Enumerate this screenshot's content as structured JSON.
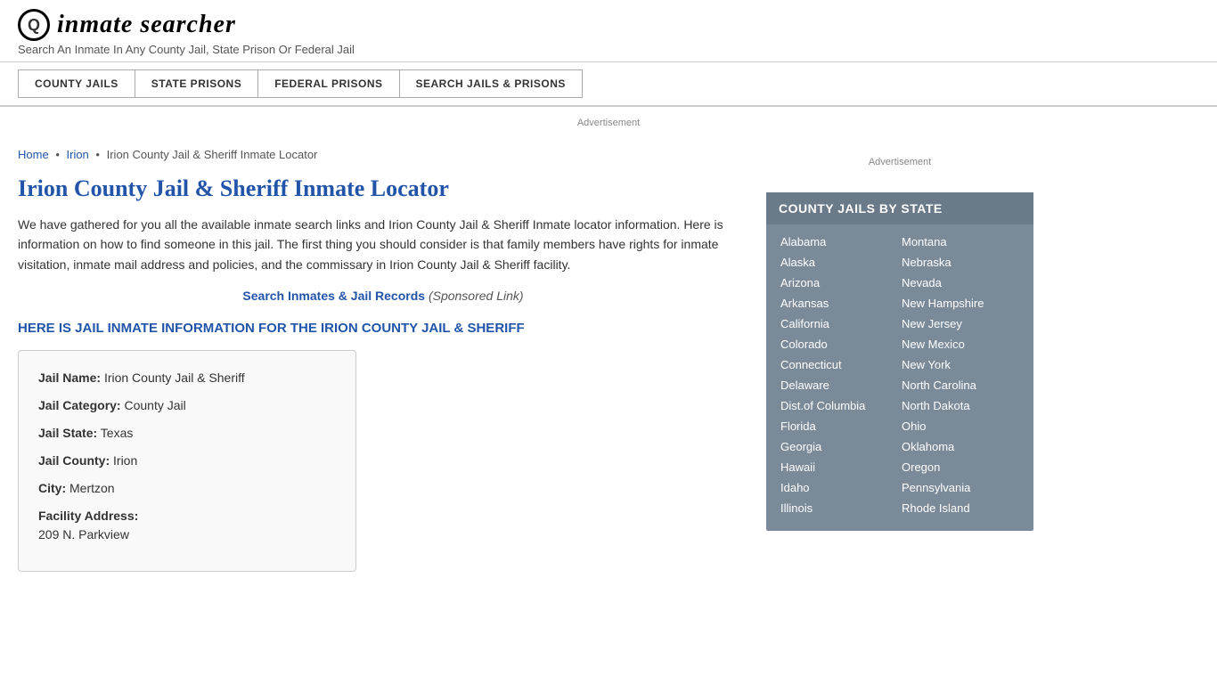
{
  "header": {
    "logo_icon": "🔍",
    "logo_text": "inmate searcher",
    "tagline": "Search An Inmate In Any County Jail, State Prison Or Federal Jail"
  },
  "nav": {
    "items": [
      {
        "label": "COUNTY JAILS",
        "name": "county-jails"
      },
      {
        "label": "STATE PRISONS",
        "name": "state-prisons"
      },
      {
        "label": "FEDERAL PRISONS",
        "name": "federal-prisons"
      },
      {
        "label": "SEARCH JAILS & PRISONS",
        "name": "search-jails-prisons"
      }
    ]
  },
  "ad": {
    "top_label": "Advertisement",
    "sidebar_label": "Advertisement"
  },
  "breadcrumb": {
    "home": "Home",
    "sep1": "•",
    "irion": "Irion",
    "sep2": "•",
    "current": "Irion County Jail & Sheriff Inmate Locator"
  },
  "content": {
    "page_title": "Irion County Jail & Sheriff Inmate Locator",
    "description": "We have gathered for you all the available inmate search links and Irion County Jail & Sheriff Inmate locator information. Here is information on how to find someone in this jail. The first thing you should consider is that family members have rights for inmate visitation, inmate mail address and policies, and the commissary in Irion County Jail & Sheriff facility.",
    "sponsored_link_text": "Search Inmates & Jail Records",
    "sponsored_note": "(Sponsored Link)",
    "jail_info_heading": "HERE IS JAIL INMATE INFORMATION FOR THE IRION COUNTY JAIL & SHERIFF",
    "info": {
      "jail_name_label": "Jail Name:",
      "jail_name_value": "Irion County Jail & Sheriff",
      "jail_category_label": "Jail Category:",
      "jail_category_value": "County Jail",
      "jail_state_label": "Jail State:",
      "jail_state_value": "Texas",
      "jail_county_label": "Jail County:",
      "jail_county_value": "Irion",
      "city_label": "City:",
      "city_value": "Mertzon",
      "facility_address_label": "Facility Address:",
      "facility_address_value": "209 N. Parkview"
    }
  },
  "sidebar": {
    "county_jails_title": "COUNTY JAILS BY STATE",
    "states_left": [
      "Alabama",
      "Alaska",
      "Arizona",
      "Arkansas",
      "California",
      "Colorado",
      "Connecticut",
      "Delaware",
      "Dist.of Columbia",
      "Florida",
      "Georgia",
      "Hawaii",
      "Idaho",
      "Illinois"
    ],
    "states_right": [
      "Montana",
      "Nebraska",
      "Nevada",
      "New Hampshire",
      "New Jersey",
      "New Mexico",
      "New York",
      "North Carolina",
      "North Dakota",
      "Ohio",
      "Oklahoma",
      "Oregon",
      "Pennsylvania",
      "Rhode Island"
    ]
  }
}
